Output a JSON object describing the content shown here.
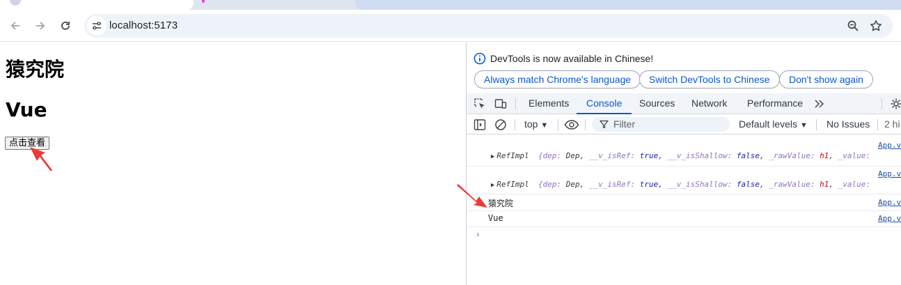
{
  "browser": {
    "address": "localhost:5173"
  },
  "page": {
    "heading1": "猿究院",
    "heading2": "Vue",
    "button_label": "点击查看"
  },
  "devtools": {
    "infobar": {
      "message": "DevTools is now available in Chinese!",
      "btn_match": "Always match Chrome's language",
      "btn_switch": "Switch DevTools to Chinese",
      "btn_dismiss": "Don't show again"
    },
    "tabs": [
      "Elements",
      "Console",
      "Sources",
      "Network",
      "Performance"
    ],
    "active_tab": "Console",
    "console_bar": {
      "context": "top",
      "filter_placeholder": "Filter",
      "levels": "Default levels",
      "issues": "No Issues",
      "hidden": "2 hi"
    },
    "logs": [
      {
        "source": "App.v",
        "type": "RefImpl",
        "preview": {
          "k1": "dep:",
          "v1": "Dep",
          "k2": "__v_isRef:",
          "v2": "true",
          "k3": "__v_isShallow:",
          "v3": "false",
          "k4": "_rawValue:",
          "v4": "h1",
          "k5": "_value:"
        }
      },
      {
        "source": "App.v",
        "type": "RefImpl",
        "preview": {
          "k1": "dep:",
          "v1": "Dep",
          "k2": "__v_isRef:",
          "v2": "true",
          "k3": "__v_isShallow:",
          "v3": "false",
          "k4": "_rawValue:",
          "v4": "h1",
          "k5": "_value:"
        }
      },
      {
        "source": "App.v",
        "text": "猿究院"
      },
      {
        "source": "App.v",
        "text": "Vue"
      }
    ]
  },
  "colors": {
    "accent": "#0b57d0",
    "annotation_arrow": "#ee3b36"
  }
}
